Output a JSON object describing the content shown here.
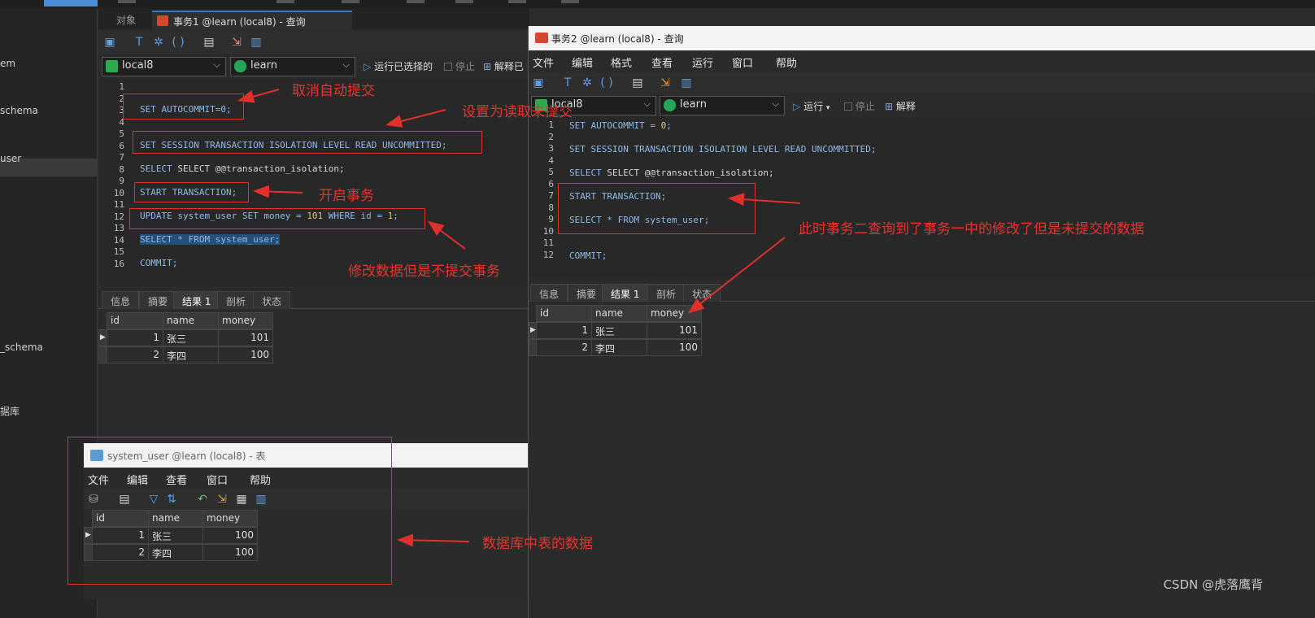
{
  "sidebar": {
    "items": [
      "em",
      "schema",
      "user",
      "_schema",
      "据库"
    ]
  },
  "window1": {
    "tabs": [
      "对象",
      "事务1 @learn (local8) - 查询"
    ],
    "connection": "local8",
    "database": "learn",
    "run_label": "运行已选择的",
    "stop_label": "停止",
    "explain_label": "解释已",
    "line_numbers": [
      "1",
      "2",
      "3",
      "4",
      "5",
      "6",
      "7",
      "8",
      "9",
      "10",
      "11",
      "12",
      "13",
      "14",
      "15",
      "16"
    ],
    "code": {
      "l3": "SET AUTOCOMMIT=0;",
      "l6": "SET SESSION TRANSACTION ISOLATION LEVEL READ UNCOMMITTED;",
      "l8": "SELECT @@transaction_isolation;",
      "l10": "START TRANSACTION;",
      "l12a": "UPDATE system_user SET money = ",
      "l12b": "101",
      "l12c": " WHERE id = ",
      "l12d": "1",
      "l12e": ";",
      "l14": "SELECT * FROM system_user;",
      "l16": "COMMIT;"
    },
    "result_tabs": [
      "信息",
      "摘要",
      "结果 1",
      "剖析",
      "状态"
    ],
    "columns": [
      "id",
      "name",
      "money"
    ],
    "rows": [
      [
        "1",
        "张三",
        "101"
      ],
      [
        "2",
        "李四",
        "100"
      ]
    ]
  },
  "window2": {
    "title": "事务2 @learn (local8) - 查询",
    "menu": [
      "文件",
      "编辑",
      "格式",
      "查看",
      "运行",
      "窗口",
      "帮助"
    ],
    "connection": "local8",
    "database": "learn",
    "run_label": "运行",
    "stop_label": "停止",
    "explain_label": "解释",
    "line_numbers": [
      "1",
      "2",
      "3",
      "4",
      "5",
      "6",
      "7",
      "8",
      "9",
      "10",
      "11",
      "12"
    ],
    "code": {
      "l1a": "SET AUTOCOMMIT = ",
      "l1b": "0",
      "l1c": ";",
      "l3": "SET SESSION TRANSACTION ISOLATION LEVEL READ UNCOMMITTED;",
      "l5": "SELECT @@transaction_isolation;",
      "l7": "START TRANSACTION;",
      "l9": "SELECT * FROM system_user;",
      "l12": "COMMIT;"
    },
    "result_tabs": [
      "信息",
      "摘要",
      "结果 1",
      "剖析",
      "状态"
    ],
    "columns": [
      "id",
      "name",
      "money"
    ],
    "rows": [
      [
        "1",
        "张三",
        "101"
      ],
      [
        "2",
        "李四",
        "100"
      ]
    ]
  },
  "window3": {
    "title": "system_user @learn (local8) - 表",
    "menu": [
      "文件",
      "编辑",
      "查看",
      "窗口",
      "帮助"
    ],
    "columns": [
      "id",
      "name",
      "money"
    ],
    "rows": [
      [
        "1",
        "张三",
        "100"
      ],
      [
        "2",
        "李四",
        "100"
      ]
    ]
  },
  "annotations": {
    "cancel_autocommit": "取消自动提交",
    "set_read_uncommitted": "设置为读取未提交",
    "start_transaction": "开启事务",
    "modify_no_commit": "修改数据但是不提交事务",
    "tx2_sees_uncommitted": "此时事务二查询到了事务一中的修改了但是未提交的数据",
    "db_table_data": "数据库中表的数据"
  },
  "watermark": "CSDN @虎落鹰背",
  "colors": {
    "annotation": "#e0302b",
    "keyword": "#8fb9e8",
    "number": "#e5c07b"
  }
}
